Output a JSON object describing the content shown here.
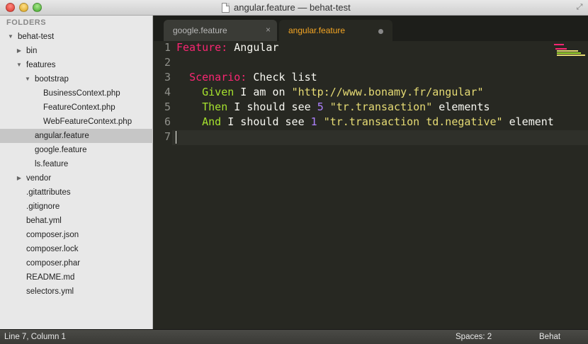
{
  "window": {
    "title": "angular.feature — behat-test"
  },
  "sidebar": {
    "header": "FOLDERS",
    "items": [
      {
        "label": "behat-test",
        "depth": 0,
        "type": "folder",
        "expanded": true
      },
      {
        "label": "bin",
        "depth": 1,
        "type": "folder",
        "expanded": false
      },
      {
        "label": "features",
        "depth": 1,
        "type": "folder",
        "expanded": true
      },
      {
        "label": "bootstrap",
        "depth": 2,
        "type": "folder",
        "expanded": true
      },
      {
        "label": "BusinessContext.php",
        "depth": 3,
        "type": "file"
      },
      {
        "label": "FeatureContext.php",
        "depth": 3,
        "type": "file"
      },
      {
        "label": "WebFeatureContext.php",
        "depth": 3,
        "type": "file"
      },
      {
        "label": "angular.feature",
        "depth": 2,
        "type": "file",
        "selected": true
      },
      {
        "label": "google.feature",
        "depth": 2,
        "type": "file"
      },
      {
        "label": "ls.feature",
        "depth": 2,
        "type": "file"
      },
      {
        "label": "vendor",
        "depth": 1,
        "type": "folder",
        "expanded": false
      },
      {
        "label": ".gitattributes",
        "depth": 1,
        "type": "file"
      },
      {
        "label": ".gitignore",
        "depth": 1,
        "type": "file"
      },
      {
        "label": "behat.yml",
        "depth": 1,
        "type": "file"
      },
      {
        "label": "composer.json",
        "depth": 1,
        "type": "file"
      },
      {
        "label": "composer.lock",
        "depth": 1,
        "type": "file"
      },
      {
        "label": "composer.phar",
        "depth": 1,
        "type": "file"
      },
      {
        "label": "README.md",
        "depth": 1,
        "type": "file"
      },
      {
        "label": "selectors.yml",
        "depth": 1,
        "type": "file"
      }
    ]
  },
  "tabs": [
    {
      "label": "google.feature",
      "active": false,
      "close_glyph": "×"
    },
    {
      "label": "angular.feature",
      "active": true,
      "dirty": true
    }
  ],
  "editor": {
    "line_numbers": [
      "1",
      "2",
      "3",
      "4",
      "5",
      "6",
      "7"
    ],
    "lines": [
      [
        {
          "t": "Feature:",
          "c": "kw-feature"
        },
        {
          "t": " Angular",
          "c": ""
        }
      ],
      [],
      [
        {
          "t": "  ",
          "c": ""
        },
        {
          "t": "Scenario:",
          "c": "kw-scenario"
        },
        {
          "t": " Check list",
          "c": ""
        }
      ],
      [
        {
          "t": "    ",
          "c": ""
        },
        {
          "t": "Given",
          "c": "kw-step"
        },
        {
          "t": " I am on ",
          "c": ""
        },
        {
          "t": "\"http://www.bonamy.fr/angular\"",
          "c": "str"
        }
      ],
      [
        {
          "t": "    ",
          "c": ""
        },
        {
          "t": "Then",
          "c": "kw-step"
        },
        {
          "t": " I should see ",
          "c": ""
        },
        {
          "t": "5",
          "c": "num"
        },
        {
          "t": " ",
          "c": ""
        },
        {
          "t": "\"tr.transaction\"",
          "c": "str"
        },
        {
          "t": " elements",
          "c": ""
        }
      ],
      [
        {
          "t": "    ",
          "c": ""
        },
        {
          "t": "And",
          "c": "kw-step"
        },
        {
          "t": " I should see ",
          "c": ""
        },
        {
          "t": "1",
          "c": "num"
        },
        {
          "t": " ",
          "c": ""
        },
        {
          "t": "\"tr.transaction td.negative\"",
          "c": "str"
        },
        {
          "t": " element",
          "c": ""
        }
      ],
      []
    ]
  },
  "statusbar": {
    "position": "Line 7, Column 1",
    "indentation": "Spaces: 2",
    "syntax": "Behat"
  },
  "colors": {
    "keyword": "#f92672",
    "step": "#a6e22e",
    "string": "#e6db74",
    "number": "#ae81ff",
    "active_tab_text": "#f5a623"
  }
}
